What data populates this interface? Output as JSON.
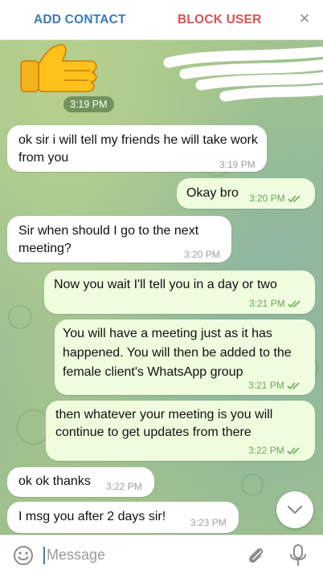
{
  "topbar": {
    "add_contact": "ADD CONTACT",
    "block_user": "BLOCK USER",
    "close_glyph": "×"
  },
  "pinned_time": "3:19 PM",
  "messages": [
    {
      "side": "in",
      "text": "ok sir i will tell my friends he will take work from you",
      "time": "3:19 PM"
    },
    {
      "side": "out",
      "text": "Okay bro",
      "time": "3:20 PM"
    },
    {
      "side": "in",
      "text": "Sir when should I go to the next meeting?",
      "time": "3:20 PM"
    },
    {
      "side": "out",
      "text": "Now you wait I'll tell you in a day or two",
      "time": "3:21 PM"
    },
    {
      "side": "out",
      "text": "You will have a meeting just as it has happened.  You will then be added to the female client's WhatsApp group",
      "time": "3:21 PM"
    },
    {
      "side": "out",
      "text": "then whatever your meeting is you will continue to get updates from there",
      "time": "3:22 PM"
    },
    {
      "side": "in",
      "text": "ok ok thanks",
      "time": "3:22 PM"
    },
    {
      "side": "in",
      "text": "I msg you after 2 days sir!",
      "time": "3:23 PM"
    }
  ],
  "composer": {
    "placeholder": "Message"
  },
  "colors": {
    "add_contact": "#3c7cb8",
    "block_user": "#d9534f",
    "outgoing_bubble": "#effdde",
    "incoming_bubble": "#ffffff",
    "read_ticks": "#6aa65c"
  },
  "icons": [
    "thumbs-up-emoji",
    "close-icon",
    "double-check-icon",
    "emoji-icon",
    "attach-icon",
    "mic-icon",
    "chevron-down-icon"
  ]
}
